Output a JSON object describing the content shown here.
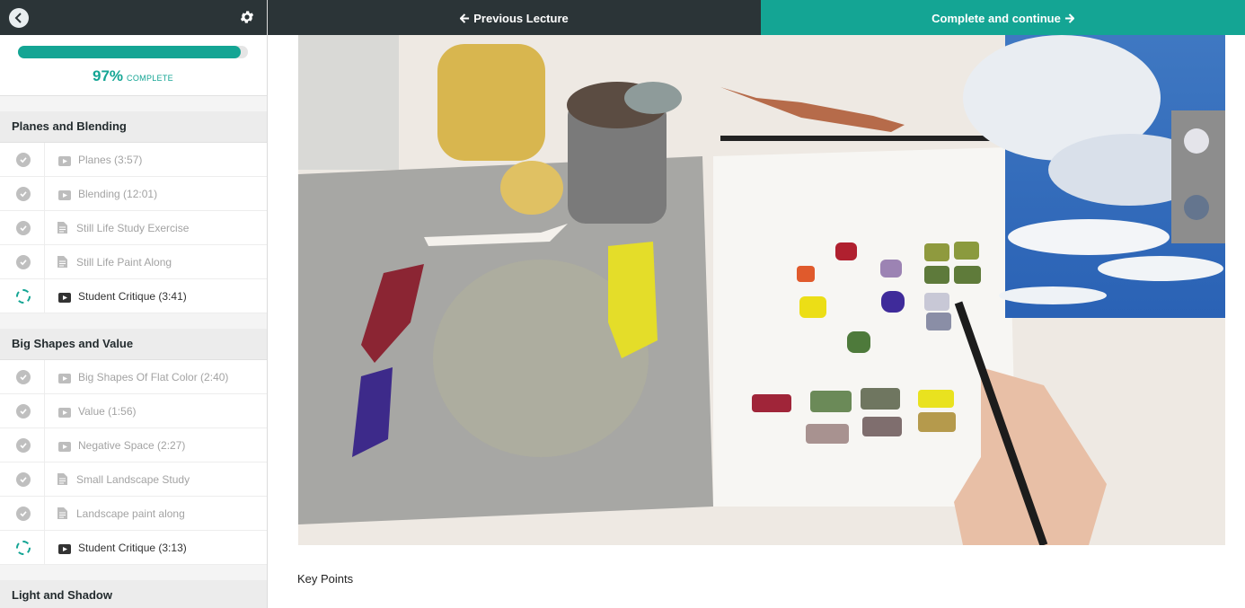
{
  "sidebar": {
    "progress": {
      "percent": "97%",
      "word": "COMPLETE",
      "fill_fraction": 0.97
    },
    "sections": [
      {
        "title": "Planes and Blending",
        "items": [
          {
            "label": "Planes (3:57)",
            "type": "video-icon",
            "state": "complete"
          },
          {
            "label": "Blending (12:01)",
            "type": "video-icon",
            "state": "complete"
          },
          {
            "label": "Still Life Study Exercise",
            "type": "document-icon",
            "state": "complete"
          },
          {
            "label": "Still Life Paint Along",
            "type": "document-icon",
            "state": "complete"
          },
          {
            "label": "Student Critique (3:41)",
            "type": "video-icon",
            "state": "in-progress"
          }
        ]
      },
      {
        "title": "Big Shapes and Value",
        "items": [
          {
            "label": "Big Shapes Of Flat Color (2:40)",
            "type": "video-icon",
            "state": "complete"
          },
          {
            "label": "Value (1:56)",
            "type": "video-icon",
            "state": "complete"
          },
          {
            "label": "Negative Space (2:27)",
            "type": "video-icon",
            "state": "complete"
          },
          {
            "label": "Small Landscape Study",
            "type": "document-icon",
            "state": "complete"
          },
          {
            "label": "Landscape paint along",
            "type": "document-icon",
            "state": "complete"
          },
          {
            "label": "Student Critique (3:13)",
            "type": "video-icon",
            "state": "in-progress"
          }
        ]
      },
      {
        "title": "Light and Shadow",
        "items": []
      }
    ]
  },
  "nav": {
    "previous_label": "Previous Lecture",
    "next_label": "Complete and continue"
  },
  "content": {
    "heading": "Key Points"
  },
  "colors": {
    "accent": "#14a594",
    "dark": "#2b3437"
  }
}
